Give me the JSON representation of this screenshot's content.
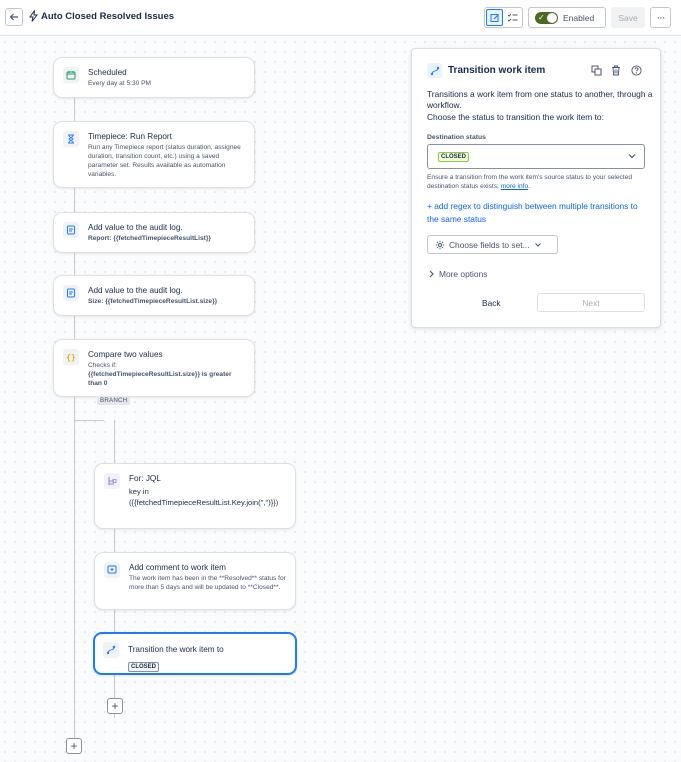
{
  "header": {
    "title": "Auto Closed Resolved Issues",
    "enabled_label": "Enabled",
    "save_label": "Save",
    "back_icon": "arrow-left-icon",
    "more_icon": "ellipsis-icon"
  },
  "nodes": [
    {
      "title": "Scheduled",
      "sub": "Every day at 5:30 PM",
      "icon": "calendar-icon"
    },
    {
      "title": "Timepiece: Run Report",
      "sub": "Run any Timepiece report (status duration, assignee duration, transition count, etc.) using a saved parameter set. Results available as automation variables.",
      "icon": "hourglass-icon"
    },
    {
      "title": "Add value to the audit log.",
      "sub": "Report: {{fetchedTimepieceResultList}}",
      "icon": "log-icon"
    },
    {
      "title": "Add value to the audit log.",
      "sub": "Size: {{fetchedTimepieceResultList.size}}",
      "icon": "log-icon"
    },
    {
      "title": "Compare two values",
      "sub_line1": "Checks if:",
      "sub_line2": "{{fetchedTimepieceResultList.size}} is greater than 0",
      "icon": "braces-icon"
    }
  ],
  "branch": {
    "label": "BRANCH",
    "nodes": [
      {
        "title": "For: JQL",
        "sub": "key in ({{fetchedTimepieceResultList.Key.join(\",\")}})",
        "icon": "branch-icon"
      },
      {
        "title": "Add comment to work item",
        "sub": "The work item has been in the **Resolved** status for more than 5 days and will be updated to **Closed**.",
        "icon": "comment-icon"
      },
      {
        "title": "Transition the work item to",
        "lozenge": "CLOSED",
        "icon": "transition-icon"
      }
    ]
  },
  "panel": {
    "title": "Transition work item",
    "description": "Transitions a work item from one status to another, through a workflow.",
    "description2": "Choose the status to transition the work item to:",
    "field_label": "Destination status",
    "selected_status": "CLOSED",
    "help_text": "Ensure a transition from the work item's source status to your selected destination status exists;",
    "help_link": "more info",
    "help_suffix": ".",
    "regex_link": "+ add regex to distinguish between multiple transitions to the same status",
    "choose_fields": "Choose fields to set...",
    "more_options": "More options",
    "back_label": "Back",
    "next_label": "Next"
  },
  "colors": {
    "accent": "#1d7afc",
    "toggle_on": "#4a6b1f",
    "status_green_border": "#94c748"
  }
}
